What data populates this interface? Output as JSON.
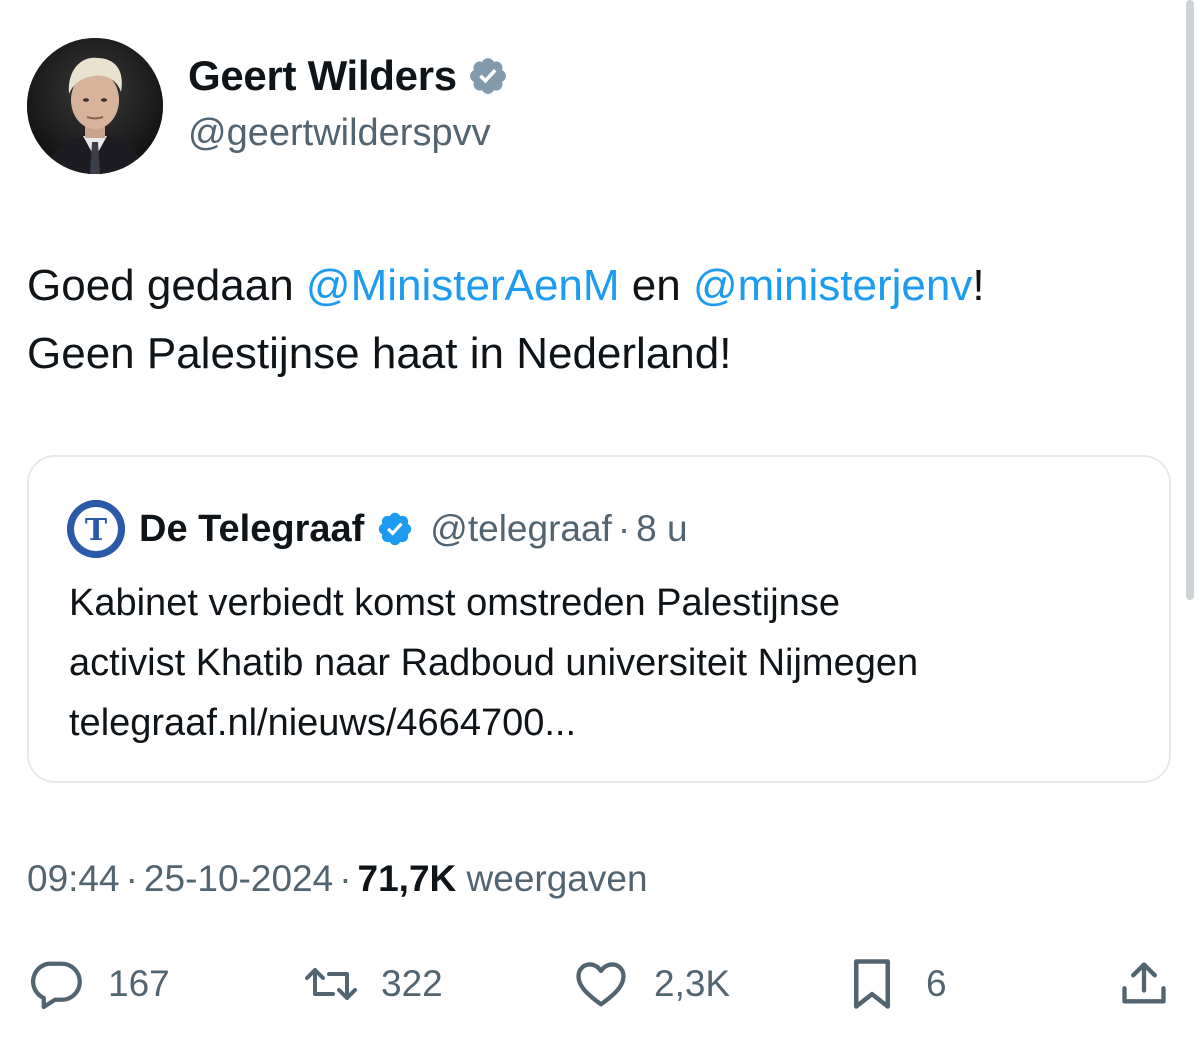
{
  "author": {
    "display_name": "Geert Wilders",
    "handle": "@geertwilderspvv",
    "verified_badge": "grey-verified-badge-icon",
    "avatar": "avatar-photo"
  },
  "tweet": {
    "line1": {
      "prefix": "Goed gedaan ",
      "mention1": "@MinisterAenM",
      "middle": " en ",
      "mention2": "@ministerjenv",
      "suffix": "!"
    },
    "line2": "Geen Palestijnse haat in Nederland!"
  },
  "quote": {
    "source_name": "De Telegraaf",
    "logo_letter": "T",
    "verified_badge": "blue-verified-badge-icon",
    "handle": "@telegraaf",
    "separator": "·",
    "time": "8 u",
    "body_line1": "Kabinet verbiedt komst omstreden Palestijnse",
    "body_line2": "activist Khatib naar Radboud universiteit Nijmegen",
    "link": "telegraaf.nl/nieuws/4664700..."
  },
  "meta": {
    "time": "09:44",
    "date": "25-10-2024",
    "views_count": "71,7K",
    "views_label": "weergaven",
    "separator": "·"
  },
  "actions": {
    "replies": {
      "icon": "reply-icon",
      "count": "167"
    },
    "reposts": {
      "icon": "repost-icon",
      "count": "322"
    },
    "likes": {
      "icon": "heart-icon",
      "count": "2,3K"
    },
    "bookmarks": {
      "icon": "bookmark-icon",
      "count": "6"
    },
    "share": {
      "icon": "share-icon"
    }
  },
  "colors": {
    "text": "#0f1419",
    "secondary": "#536471",
    "link": "#1d9bf0",
    "border": "#e5e9ec",
    "grey_badge": "#829aab",
    "blue_badge": "#1d9bf0",
    "telegraaf_logo": "#2a5aa8"
  }
}
